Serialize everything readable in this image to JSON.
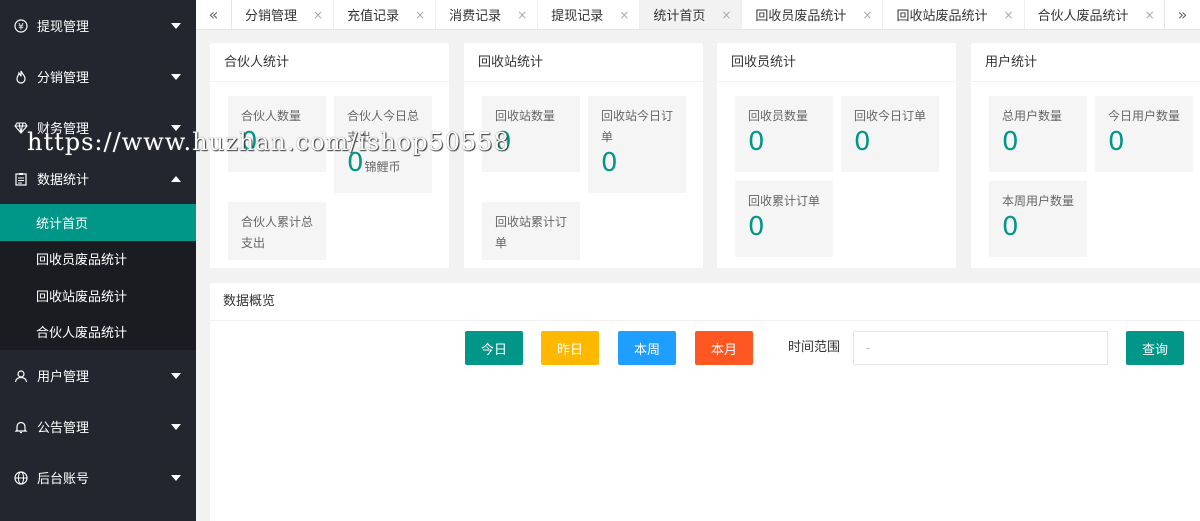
{
  "sidebar": {
    "groups": [
      {
        "label": "提现管理",
        "icon": "yen-icon"
      },
      {
        "label": "分销管理",
        "icon": "flame-icon"
      },
      {
        "label": "财务管理",
        "icon": "diamond-icon"
      },
      {
        "label": "数据统计",
        "icon": "clipboard-icon"
      },
      {
        "label": "用户管理",
        "icon": "user-icon"
      },
      {
        "label": "公告管理",
        "icon": "bell-icon"
      },
      {
        "label": "后台账号",
        "icon": "globe-icon"
      }
    ],
    "subitems": [
      {
        "label": "统计首页"
      },
      {
        "label": "回收员废品统计"
      },
      {
        "label": "回收站废品统计"
      },
      {
        "label": "合伙人废品统计"
      }
    ]
  },
  "tabs": [
    {
      "label": "分销管理"
    },
    {
      "label": "充值记录"
    },
    {
      "label": "消费记录"
    },
    {
      "label": "提现记录"
    },
    {
      "label": "统计首页"
    },
    {
      "label": "回收员废品统计"
    },
    {
      "label": "回收站废品统计"
    },
    {
      "label": "合伙人废品统计"
    }
  ],
  "tab_nav": {
    "left": "«",
    "right": "»",
    "close": "×"
  },
  "cards": {
    "partner": {
      "title": "合伙人统计",
      "count_label": "合伙人数量",
      "count_value": "0",
      "today_label": "合伙人今日总支出",
      "today_value": "0",
      "today_unit": "锦鲤币",
      "total_label": "合伙人累计总支出"
    },
    "station": {
      "title": "回收站统计",
      "count_label": "回收站数量",
      "count_value": "0",
      "today_label": "回收站今日订单",
      "today_value": "0",
      "total_label": "回收站累计订单"
    },
    "collector": {
      "title": "回收员统计",
      "count_label": "回收员数量",
      "count_value": "0",
      "today_label": "回收今日订单",
      "today_value": "0",
      "total_label": "回收累计订单",
      "total_value": "0"
    },
    "users": {
      "title": "用户统计",
      "total_label": "总用户数量",
      "total_value": "0",
      "today_label": "今日用户数量",
      "today_value": "0",
      "week_label": "本周用户数量",
      "week_value": "0"
    }
  },
  "overview": {
    "title": "数据概览",
    "buttons": {
      "today": "今日",
      "yesterday": "昨日",
      "week": "本周",
      "month": "本月",
      "query": "查询"
    },
    "range_label": "时间范围",
    "range_value": "-"
  },
  "watermark": "https://www.huzhan.com/ishop50558",
  "colors": {
    "sidebar_bg": "#23262e",
    "active_green": "#009688",
    "yesterday_yellow": "#FFB800",
    "week_blue": "#1E9FFF",
    "month_orange": "#FF5722"
  }
}
